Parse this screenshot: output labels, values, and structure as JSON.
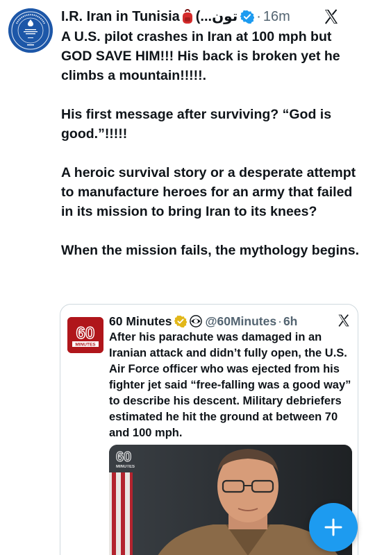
{
  "tweet": {
    "author_name": "I.R. Iran in Tunisia",
    "author_name_rtl": "(...تون",
    "separator": "·",
    "time": "16m",
    "paragraphs": [
      "A U.S. pilot crashes in Iran at 100 mph but GOD SAVE HIM!!!  His back is broken yet he climbs a mountain!!!!!.",
      "His first message after surviving? “God is good.”!!!!!",
      "A heroic survival story or a desperate attempt to manufacture heroes for an army that failed in its mission to bring Iran to its knees?",
      "When the mission fails, the mythology begins."
    ],
    "icons": {
      "avatar": "iran-embassy-seal",
      "emoji": "backpack-emoji",
      "verified": "verified-badge",
      "logo": "x-logo"
    }
  },
  "quote": {
    "author_name": "60 Minutes",
    "handle": "@60Minutes",
    "separator": "·",
    "time": "6h",
    "avatar_text": "60",
    "avatar_subtext": "MINUTES",
    "text": "After his parachute was damaged in an Iranian attack and didn’t fully open, the U.S. Air Force officer who was ejected from his fighter jet said “free-falling was a good way” to describe his descent. Military debriefers estimated he hit the ground at between 70 and 100 mph.",
    "media_watermark": "60",
    "media_watermark_sub": "MINUTES",
    "icons": {
      "badge": "gold-verified-badge",
      "affiliate": "cbs-eye-icon",
      "logo": "x-logo"
    }
  },
  "fab": {
    "icon": "plus-icon",
    "color": "#1d9bf0"
  },
  "colors": {
    "text": "#0f1419",
    "secondary": "#536471",
    "verified": "#1d9bf0",
    "gold_badge": "#e2b719",
    "brand_red": "#b0161b"
  }
}
